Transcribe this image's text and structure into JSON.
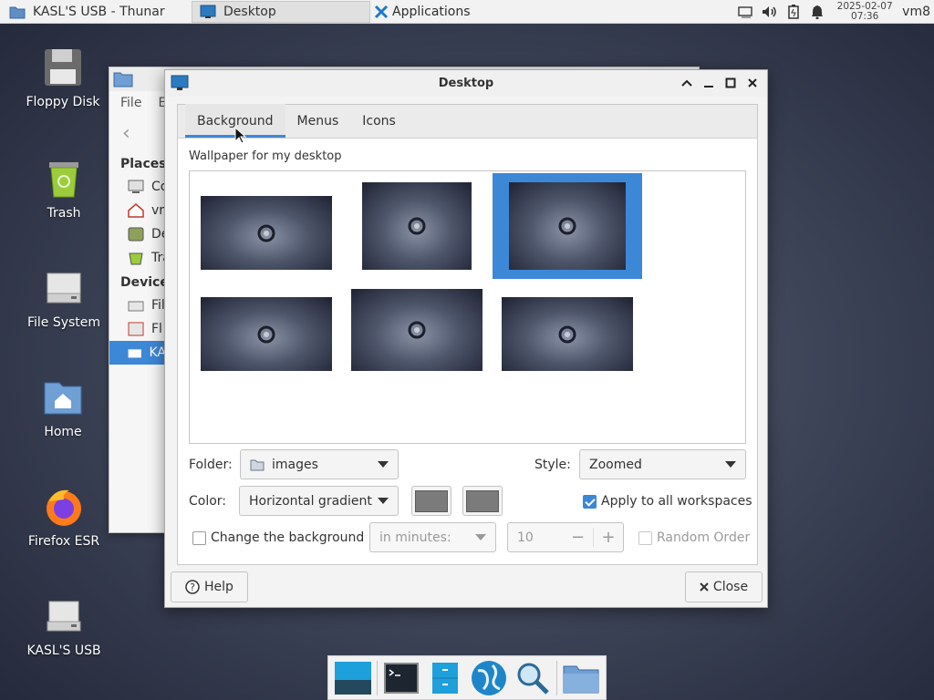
{
  "panel": {
    "tasks": [
      {
        "label": "KASL'S USB - Thunar",
        "icon": "folder-icon"
      },
      {
        "label": "Desktop",
        "icon": "desktop-settings-icon"
      }
    ],
    "apps_label": "Applications",
    "clock_date": "2025-02-07",
    "clock_time": "07:36",
    "user": "vm8",
    "tray_icons": [
      "network-icon",
      "volume-icon",
      "battery-icon",
      "notification-bell-icon"
    ]
  },
  "desktop_icons": [
    {
      "label": "Floppy Disk",
      "icon": "floppy-disk-icon"
    },
    {
      "label": "Trash",
      "icon": "trash-icon"
    },
    {
      "label": "File System",
      "icon": "drive-icon"
    },
    {
      "label": "Home",
      "icon": "home-folder-icon"
    },
    {
      "label": "Firefox ESR",
      "icon": "firefox-icon"
    },
    {
      "label": "KASL'S USB",
      "icon": "usb-drive-icon"
    }
  ],
  "thunar": {
    "menu": [
      "File",
      "E"
    ],
    "places_heading": "Places",
    "places": [
      "Co",
      "vr",
      "De",
      "Tra"
    ],
    "devices_heading": "Device",
    "devices": [
      "Fil",
      "Fl",
      "KA"
    ]
  },
  "dialog": {
    "title": "Desktop",
    "tabs": [
      "Background",
      "Menus",
      "Icons"
    ],
    "active_tab": "Background",
    "wallpaper_label": "Wallpaper for my desktop",
    "folder_label": "Folder:",
    "folder_value": "images",
    "style_label": "Style:",
    "style_value": "Zoomed",
    "color_label": "Color:",
    "color_value": "Horizontal gradient",
    "color1": "#7b7b7b",
    "color2": "#7b7b7b",
    "apply_all_label": "Apply to all workspaces",
    "apply_all_checked": true,
    "change_bg_label": "Change the background",
    "change_bg_checked": false,
    "interval_unit": "in minutes:",
    "interval_value": "10",
    "random_label": "Random Order",
    "random_checked": false,
    "help_label": "Help",
    "close_label": "Close"
  },
  "dock": [
    "show-desktop-icon",
    "terminal-icon",
    "file-cabinet-icon",
    "browser-globe-icon",
    "app-finder-icon",
    "folder-icon"
  ],
  "colors": {
    "accent": "#3d87d7"
  }
}
